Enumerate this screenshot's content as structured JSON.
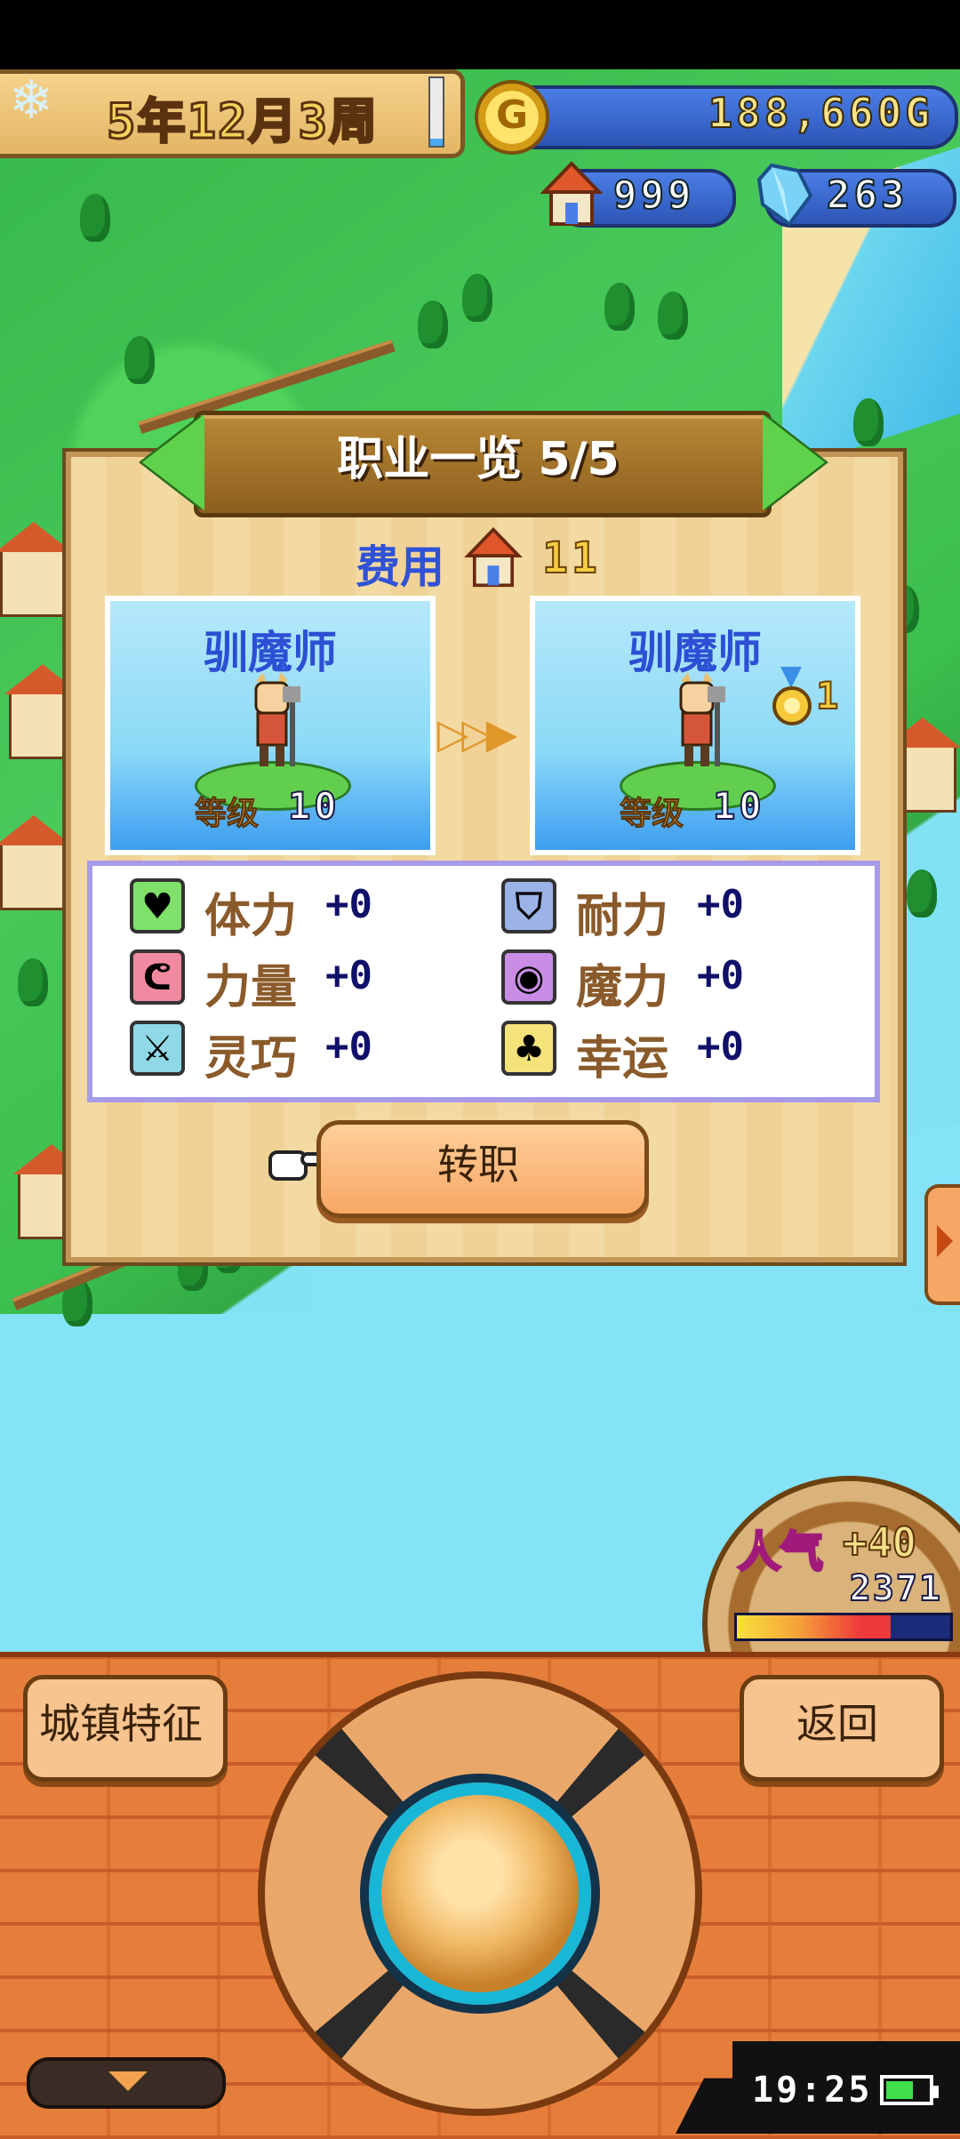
{
  "hud": {
    "date": "5年12月3周",
    "date_progress": 0.1,
    "gold": "188,660G",
    "coin_letter": "G",
    "houses": "999",
    "crystals": "263"
  },
  "dialog": {
    "title": "职业一览 5/5",
    "cost_label": "费用",
    "cost_value": "11",
    "from_job": {
      "name": "驯魔师",
      "level_label": "等级",
      "level": "10"
    },
    "to_job": {
      "name": "驯魔师",
      "level_label": "等级",
      "level": "10",
      "medal_count": "1"
    },
    "stats": [
      {
        "label": "体力",
        "value": "+0",
        "icon": "heart-icon",
        "color": "#7fe06a"
      },
      {
        "label": "耐力",
        "value": "+0",
        "icon": "shield-icon",
        "color": "#9bb3e6"
      },
      {
        "label": "力量",
        "value": "+0",
        "icon": "arm-icon",
        "color": "#f18aa0"
      },
      {
        "label": "魔力",
        "value": "+0",
        "icon": "magic-orb-icon",
        "color": "#c98de6"
      },
      {
        "label": "灵巧",
        "value": "+0",
        "icon": "crossed-swords-icon",
        "color": "#8fd8e6"
      },
      {
        "label": "幸运",
        "value": "+0",
        "icon": "clover-icon",
        "color": "#f4e27a"
      }
    ],
    "action_label": "转职"
  },
  "popularity": {
    "label": "人气",
    "bonus": "+40",
    "value": "2371",
    "bar_fill": 0.72
  },
  "bottom": {
    "town_button": "城镇特征",
    "back_button": "返回"
  },
  "system": {
    "clock": "19:25",
    "battery_level": 0.7
  }
}
